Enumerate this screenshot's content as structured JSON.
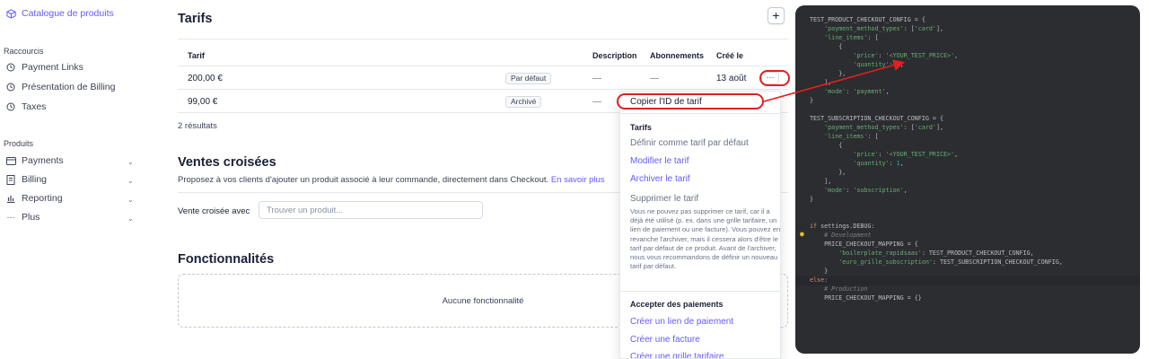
{
  "sidebar": {
    "catalogue": "Catalogue de produits",
    "shortcuts_title": "Raccourcis",
    "shortcuts": [
      "Payment Links",
      "Présentation de Billing",
      "Taxes"
    ],
    "products_title": "Produits",
    "products": [
      "Payments",
      "Billing",
      "Reporting",
      "Plus"
    ]
  },
  "tarifs": {
    "title": "Tarifs",
    "add_label": "+",
    "headers": [
      "Tarif",
      "Description",
      "Abonnements",
      "Créé le"
    ],
    "rows": [
      {
        "price": "200,00 €",
        "badge": "Par défaut",
        "description": "—",
        "subscriptions": "—",
        "created": "13 août"
      },
      {
        "price": "99,00 €",
        "badge": "Archivé",
        "description": "—"
      }
    ],
    "results": "2 résultats",
    "more_label": "···"
  },
  "cross_sell": {
    "title": "Ventes croisées",
    "text": "Proposez à vos clients d'ajouter un produit associé à leur commande, directement dans Checkout.",
    "link": "En savoir plus",
    "field_label": "Vente croisée avec",
    "placeholder": "Trouver un produit..."
  },
  "features": {
    "title": "Fonctionnalités",
    "empty": "Aucune fonctionnalité"
  },
  "menu": {
    "copy_id": "Copier l'ID de tarif",
    "section_tarifs": "Tarifs",
    "set_default": "Définir comme tarif par défaut",
    "edit": "Modifier le tarif",
    "archive": "Archiver le tarif",
    "delete": "Supprimer le tarif",
    "delete_desc": "Vous ne pouvez pas supprimer ce tarif, car il a déjà été utilisé (p. ex. dans une grille tarifaire, un lien de paiement ou une facture). Vous pouvez en revanche l'archiver, mais il cessera alors d'être le tarif par défaut de ce produit. Avant de l'archiver, nous vous recommandons de définir un nouveau tarif par défaut.",
    "section_payments": "Accepter des paiements",
    "create_link": "Créer un lien de paiement",
    "create_invoice": "Créer une facture",
    "create_table": "Créer une grille tarifaire"
  },
  "code": {
    "product_config": "TEST_PRODUCT_CHECKOUT_CONFIG",
    "subscription_config": "TEST_SUBSCRIPTION_CHECKOUT_CONFIG",
    "key_pm_types": "'payment_method_types'",
    "card": "'card'",
    "key_line_items": "'line_items'",
    "key_price": "'price'",
    "price_placeholder": "'<YOUR_TEST_PRICE>'",
    "key_quantity": "'quantity'",
    "quantity": "1",
    "key_mode": "'mode'",
    "mode_payment": "'payment'",
    "mode_subscription": "'subscription'",
    "kw_if": "if",
    "debug": "settings.DEBUG:",
    "comment_dev": "# Development",
    "mapping": "PRICE_CHECKOUT_MAPPING",
    "key_boilerplate": "'boilerplate_rapidsaas'",
    "key_euro": "'euro_grille_subscription'",
    "kw_else": "else:",
    "comment_prod": "# Production",
    "empty_dict": "{}"
  },
  "colors": {
    "accent": "#635bff",
    "annotation": "#e02020",
    "code_bg": "#2b2d30"
  }
}
